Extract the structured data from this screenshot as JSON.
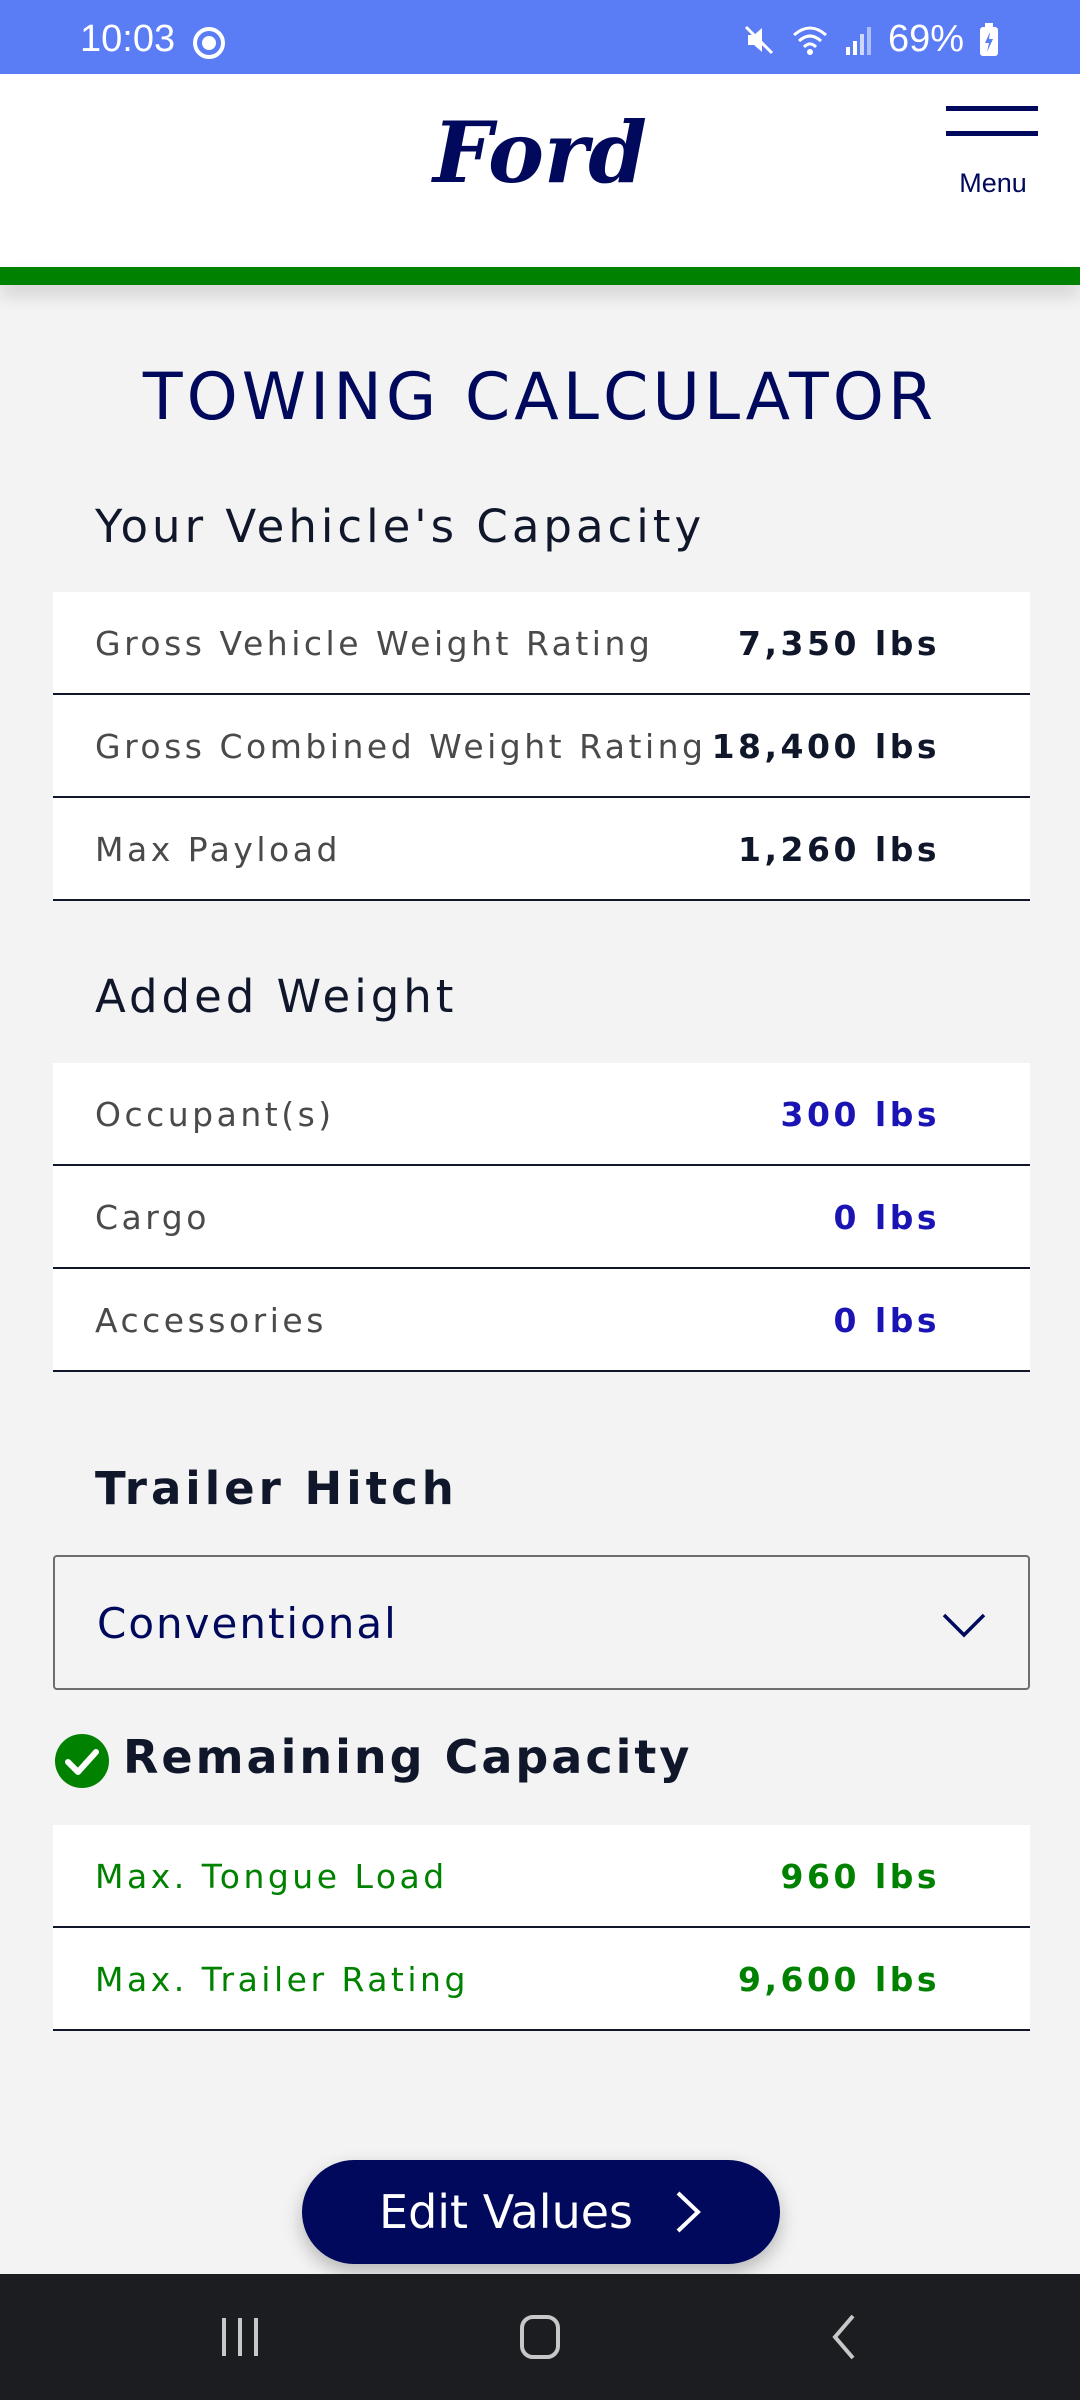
{
  "status_bar": {
    "time": "10:03",
    "battery": "69%",
    "icons": [
      "mute-icon",
      "wifi-icon",
      "signal-icon",
      "battery-icon"
    ]
  },
  "header": {
    "logo_text": "Ford",
    "menu_label": "Menu",
    "accent_green": "#008200",
    "brand_blue": "#00095b"
  },
  "page": {
    "title": "TOWING CALCULATOR"
  },
  "capacity": {
    "title": "Your Vehicle's Capacity",
    "rows": [
      {
        "label": "Gross Vehicle Weight Rating",
        "value": "7,350 lbs"
      },
      {
        "label": "Gross Combined Weight Rating",
        "value": "18,400 lbs"
      },
      {
        "label": "Max Payload",
        "value": "1,260 lbs"
      }
    ]
  },
  "added_weight": {
    "title": "Added Weight",
    "rows": [
      {
        "label": "Occupant(s)",
        "value": "300 lbs"
      },
      {
        "label": "Cargo",
        "value": "0 lbs"
      },
      {
        "label": "Accessories",
        "value": "0 lbs"
      }
    ]
  },
  "trailer_hitch": {
    "title": "Trailer Hitch",
    "selected": "Conventional"
  },
  "remaining": {
    "title": "Remaining Capacity",
    "rows": [
      {
        "label": "Max. Tongue Load",
        "value": "960 lbs"
      },
      {
        "label": "Max. Trailer Rating",
        "value": "9,600 lbs"
      }
    ]
  },
  "actions": {
    "edit_label": "Edit Values"
  }
}
